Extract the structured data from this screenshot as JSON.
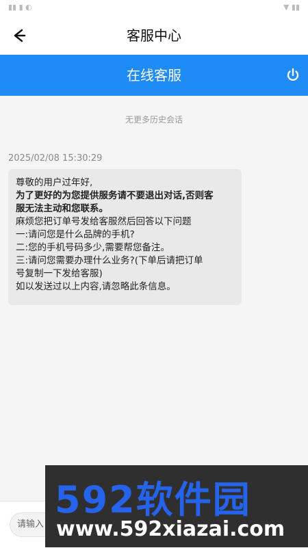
{
  "header": {
    "title": "客服中心"
  },
  "service_bar": {
    "title": "在线客服"
  },
  "chat": {
    "no_more_history": "无更多历史会话",
    "timestamp": "2025/02/08 15:30:29",
    "message_lines": [
      "尊敬的用户过年好,",
      "为了更好的为您提供服务请不要退出对话,否则客",
      "服无法主动和您联系。",
      "麻烦您把订单号发给客服然后回答以下问题",
      "一:请问您是什么品牌的手机?",
      "二:您的手机号码多少,需要帮您备注。",
      "三:请问您需要办理什么业务?(下单后请把订单",
      "号复制一下发给客服)",
      "如以发送过以上内容,请忽略此条信息。"
    ]
  },
  "input": {
    "placeholder": "请输入"
  },
  "watermark": {
    "line1": "592软件园",
    "line2": "www.592xiazai.com"
  },
  "colors": {
    "accent": "#1f8cf6"
  },
  "icons": {
    "back": "arrow-left-icon",
    "power": "power-icon"
  }
}
